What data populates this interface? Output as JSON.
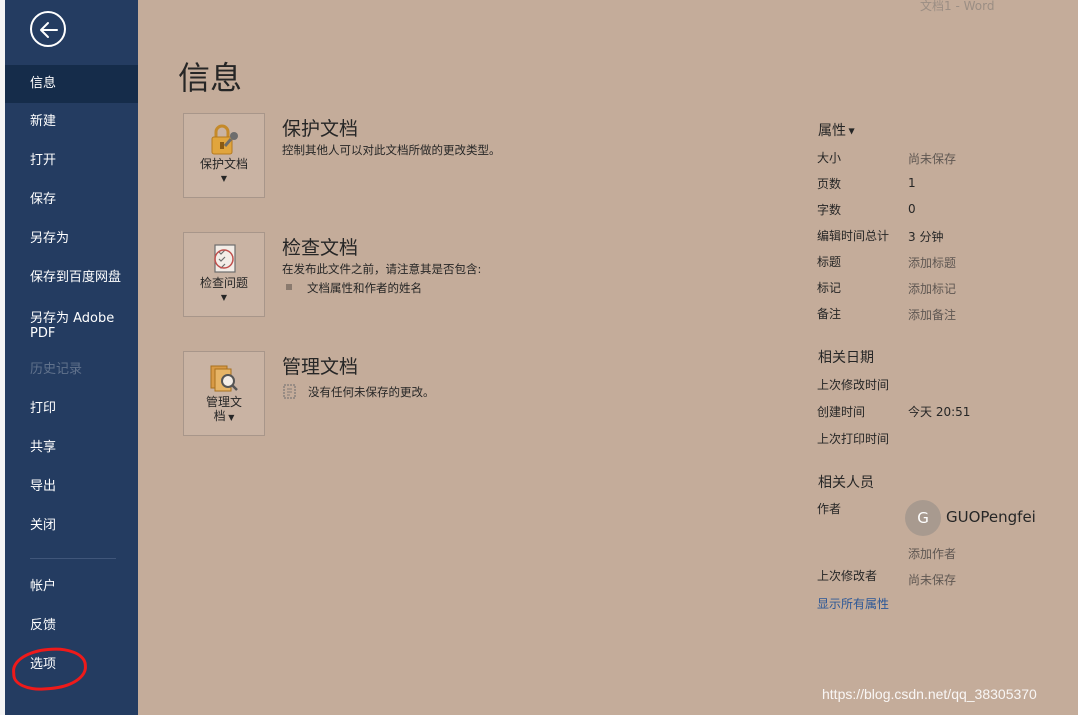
{
  "window_title": "文档1  -  Word",
  "page_title": "信息",
  "sidebar": {
    "items": [
      {
        "label": "信息",
        "active": true
      },
      {
        "label": "新建"
      },
      {
        "label": "打开"
      },
      {
        "label": "保存"
      },
      {
        "label": "另存为"
      },
      {
        "label": "保存到百度网盘"
      },
      {
        "label": "另存为 Adobe PDF"
      },
      {
        "label": "历史记录",
        "disabled": true
      },
      {
        "label": "打印"
      },
      {
        "label": "共享"
      },
      {
        "label": "导出"
      },
      {
        "label": "关闭"
      },
      {
        "label": "帐户"
      },
      {
        "label": "反馈"
      },
      {
        "label": "选项"
      }
    ]
  },
  "sections": {
    "protect": {
      "button_label": "保护文档",
      "heading": "保护文档",
      "description": "控制其他人可以对此文档所做的更改类型。"
    },
    "inspect": {
      "button_label": "检查问题",
      "heading": "检查文档",
      "description": "在发布此文件之前，请注意其是否包含:",
      "bullet": "文档属性和作者的姓名"
    },
    "manage": {
      "button_label_line1": "管理文",
      "button_label_line2": "档",
      "heading": "管理文档",
      "description": "没有任何未保存的更改。"
    }
  },
  "properties": {
    "header": "属性",
    "rows": [
      {
        "key": "大小",
        "value": "尚未保存"
      },
      {
        "key": "页数",
        "value": "1"
      },
      {
        "key": "字数",
        "value": "0"
      },
      {
        "key": "编辑时间总计",
        "value": "3 分钟"
      },
      {
        "key": "标题",
        "value": "添加标题"
      },
      {
        "key": "标记",
        "value": "添加标记"
      },
      {
        "key": "备注",
        "value": "添加备注"
      }
    ]
  },
  "related_dates": {
    "header": "相关日期",
    "rows": [
      {
        "key": "上次修改时间",
        "value": ""
      },
      {
        "key": "创建时间",
        "value": "今天 20:51"
      },
      {
        "key": "上次打印时间",
        "value": ""
      }
    ]
  },
  "related_people": {
    "header": "相关人员",
    "author_key": "作者",
    "avatar_initial": "G",
    "author_name": "GUOPengfei",
    "add_author": "添加作者",
    "last_modified_by_key": "上次修改者",
    "last_modified_by_value": "尚未保存"
  },
  "show_all_properties": "显示所有属性",
  "watermark": "https://blog.csdn.net/qq_38305370",
  "colors": {
    "sidebar": "#243c61",
    "sidebar_active": "#152c4a",
    "background": "#c4ac9a",
    "link": "#2b5797",
    "annotation": "#ee1a1a"
  }
}
